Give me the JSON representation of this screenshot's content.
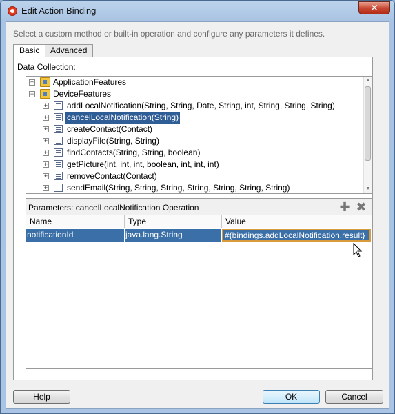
{
  "window": {
    "title": "Edit Action Binding",
    "close_glyph": "✕"
  },
  "instruction": "Select a custom method or built-in operation and configure any parameters it defines.",
  "tabs": [
    {
      "label": "Basic",
      "active": true
    },
    {
      "label": "Advanced",
      "active": false
    }
  ],
  "data_collection_label": "Data Collection:",
  "tree": {
    "nodes": [
      {
        "label": "ApplicationFeatures",
        "icon": "folder-icon",
        "level": 0,
        "expander": "+"
      },
      {
        "label": "DeviceFeatures",
        "icon": "folder-icon",
        "level": 0,
        "expander": "−"
      },
      {
        "label": "addLocalNotification(String, String, Date, String, int, String, String, String)",
        "icon": "method-icon",
        "level": 1,
        "expander": "+"
      },
      {
        "label": "cancelLocalNotification(String)",
        "icon": "method-icon",
        "level": 1,
        "expander": "+",
        "selected": true
      },
      {
        "label": "createContact(Contact)",
        "icon": "method-icon",
        "level": 1,
        "expander": "+"
      },
      {
        "label": "displayFile(String, String)",
        "icon": "method-icon",
        "level": 1,
        "expander": "+"
      },
      {
        "label": "findContacts(String, String, boolean)",
        "icon": "method-icon",
        "level": 1,
        "expander": "+"
      },
      {
        "label": "getPicture(int, int, int, boolean, int, int, int)",
        "icon": "method-icon",
        "level": 1,
        "expander": "+"
      },
      {
        "label": "removeContact(Contact)",
        "icon": "method-icon",
        "level": 1,
        "expander": "+"
      },
      {
        "label": "sendEmail(String, String, String, String, String, String, String)",
        "icon": "method-icon",
        "level": 1,
        "expander": "+"
      }
    ]
  },
  "parameters": {
    "title": "Parameters:  cancelLocalNotification Operation",
    "add_icon": "add-icon",
    "remove_icon": "remove-icon",
    "columns": [
      "Name",
      "Type",
      "Value"
    ],
    "rows": [
      {
        "name": "notificationId",
        "type": "java.lang.String",
        "value": "#{bindings.addLocalNotification.result}"
      }
    ]
  },
  "buttons": {
    "help": "Help",
    "ok": "OK",
    "cancel": "Cancel"
  }
}
